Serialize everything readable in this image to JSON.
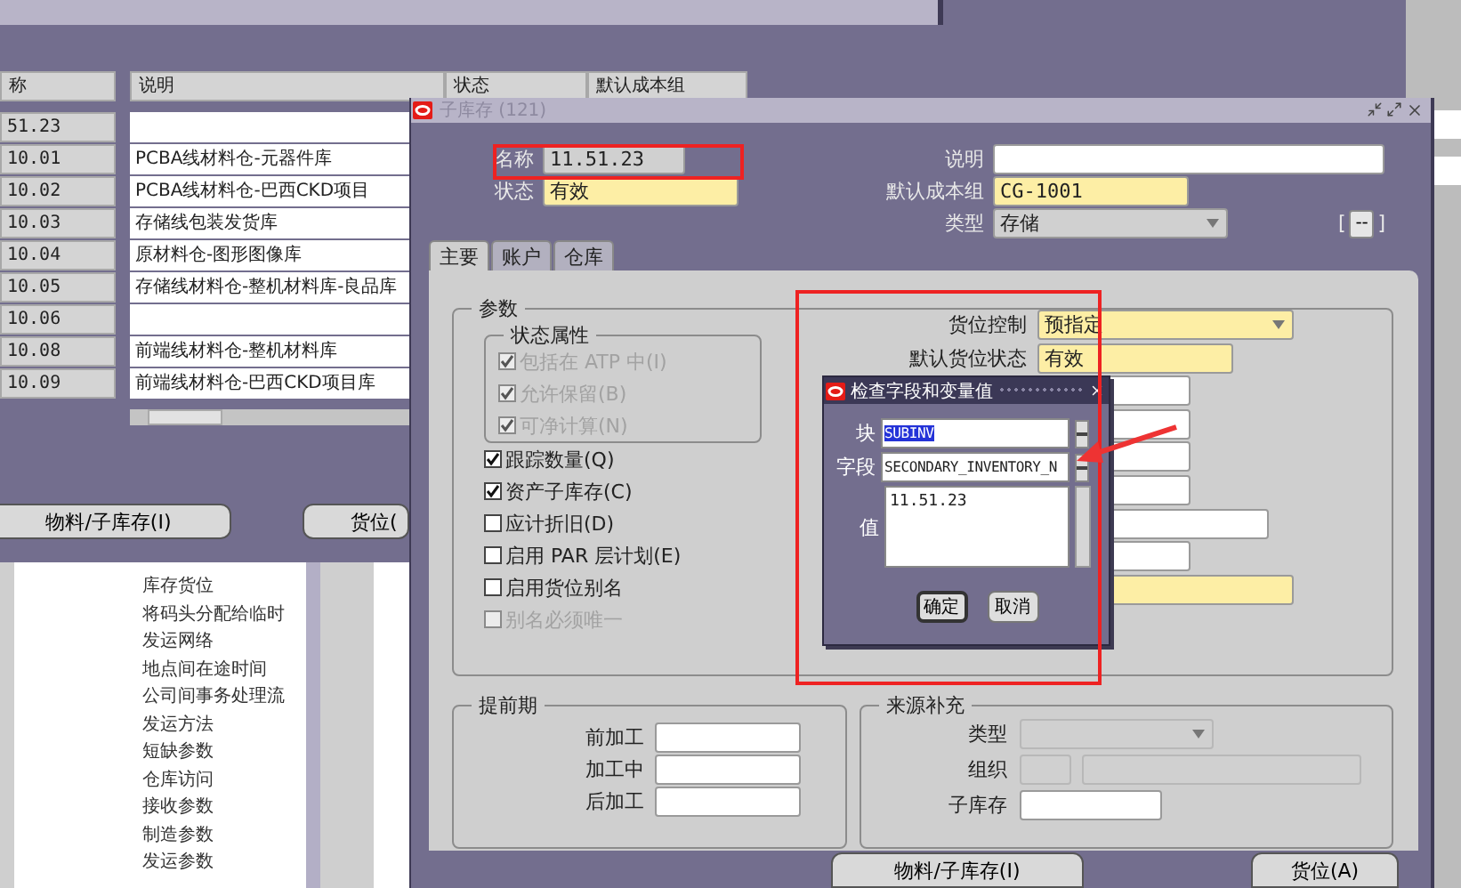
{
  "back_window": {
    "columns": [
      {
        "label": "称"
      },
      {
        "label": "说明"
      },
      {
        "label": "状态"
      },
      {
        "label": "默认成本组"
      }
    ],
    "rows": [
      {
        "name": "51.23"
      },
      {
        "name": "10.01",
        "description": "PCBA线材料仓-元器件库"
      },
      {
        "name": "10.02",
        "description": "PCBA线材料仓-巴西CKD项目"
      },
      {
        "name": "10.03",
        "description": "存储线包装发货库"
      },
      {
        "name": "10.04",
        "description": "原材料仓-图形图像库"
      },
      {
        "name": "10.05",
        "description": "存储线材料仓-整机材料库-良品库"
      },
      {
        "name": "10.06"
      },
      {
        "name": "10.08",
        "description": "前端线材料仓-整机材料库"
      },
      {
        "name": "10.09",
        "description": "前端线材料仓-巴西CKD项目库"
      }
    ],
    "buttons": [
      "物料/子库存(I)",
      "货位("
    ],
    "menu_items": [
      "库存货位",
      "将码头分配给临时",
      "发运网络",
      "地点间在途时间",
      "公司间事务处理流",
      "发运方法",
      "短缺参数",
      "仓库访问",
      "接收参数",
      "制造参数",
      "发运参数"
    ]
  },
  "window": {
    "title": "子库存 (121)",
    "header_left": [
      {
        "label": "名称",
        "value": "11.51.23",
        "kind": "readonly"
      },
      {
        "label": "状态",
        "value": "有效",
        "kind": "required"
      }
    ],
    "header_right": [
      {
        "label": "说明",
        "kind": "text"
      },
      {
        "label": "默认成本组",
        "value": "CG-1001",
        "kind": "required"
      },
      {
        "label": "类型",
        "value": "存储",
        "kind": "select"
      }
    ],
    "flex_field": {
      "open": "[",
      "button": "--",
      "close": "]"
    },
    "tabs": [
      {
        "label": "主要",
        "selected": true
      },
      {
        "label": "账户",
        "selected": false
      },
      {
        "label": "仓库",
        "selected": false
      }
    ],
    "parameters": {
      "title": "参数",
      "status_group": {
        "title": "状态属性",
        "options": [
          {
            "label": "包括在 ATP 中(I)",
            "checked": true,
            "disabled": true
          },
          {
            "label": "允许保留(B)",
            "checked": true,
            "disabled": true
          },
          {
            "label": "可净计算(N)",
            "checked": true,
            "disabled": true
          }
        ]
      },
      "options": [
        {
          "label": "跟踪数量(Q)",
          "checked": true,
          "disabled": false
        },
        {
          "label": "资产子库存(C)",
          "checked": true,
          "disabled": false
        },
        {
          "label": "应计折旧(D)",
          "checked": false,
          "disabled": false
        },
        {
          "label": "启用 PAR 层计划(E)",
          "checked": false,
          "disabled": false
        },
        {
          "label": "启用货位别名",
          "checked": false,
          "disabled": false
        },
        {
          "label": "别名必须唯一",
          "checked": false,
          "disabled": true
        }
      ],
      "fields": [
        {
          "label": "货位控制",
          "value": "预指定",
          "kind": "select_required"
        },
        {
          "label": "默认货位状态",
          "value": "有效",
          "kind": "required"
        },
        {
          "kind": "short"
        },
        {
          "kind": "short"
        },
        {
          "kind": "short"
        },
        {
          "kind": "short"
        },
        {
          "kind": "long"
        },
        {
          "kind": "short"
        },
        {
          "kind": "required_long"
        }
      ]
    },
    "lead_time": {
      "title": "提前期",
      "fields": [
        {
          "label": "前加工"
        },
        {
          "label": "加工中"
        },
        {
          "label": "后加工"
        }
      ]
    },
    "replenishment": {
      "title": "来源补充",
      "fields": [
        {
          "label": "类型",
          "kind": "select_disabled"
        },
        {
          "label": "组织",
          "kind": "org_disabled"
        },
        {
          "label": "子库存",
          "kind": "text"
        }
      ]
    },
    "buttons": [
      "物料/子库存(I)",
      "货位(A)"
    ]
  },
  "dialog": {
    "title": "检查字段和变量值",
    "fields": [
      {
        "label": "块",
        "value": "SUBINV",
        "selected": true
      },
      {
        "label": "字段",
        "value": "SECONDARY_INVENTORY_N",
        "selected": false
      }
    ],
    "value_label": "值",
    "value": "11.51.23",
    "buttons": [
      {
        "label": "确定",
        "kind": "default"
      },
      {
        "label": "取消",
        "kind": "normal"
      }
    ]
  }
}
